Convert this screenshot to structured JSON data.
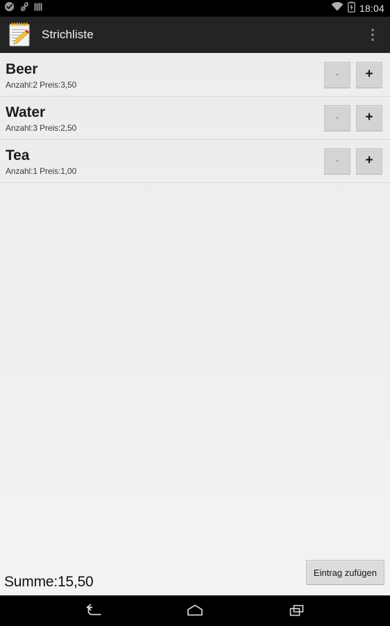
{
  "status_bar": {
    "left_icons": [
      {
        "name": "check-circle-icon"
      },
      {
        "name": "phone-link-icon"
      },
      {
        "name": "tally-bars-icon"
      }
    ],
    "right_icons": [
      {
        "name": "wifi-icon"
      },
      {
        "name": "battery-charging-icon"
      }
    ],
    "clock": "18:04"
  },
  "action_bar": {
    "app_icon": "notepad-pencil-icon",
    "title": "Strichliste",
    "overflow": "overflow-menu-icon"
  },
  "list": {
    "rows": [
      {
        "title": "Beer",
        "subtitle": "Anzahl:2 Preis:3,50",
        "count": 2,
        "price": "3,50",
        "minus_label": "-",
        "plus_label": "+"
      },
      {
        "title": "Water",
        "subtitle": "Anzahl:3 Preis:2,50",
        "count": 3,
        "price": "2,50",
        "minus_label": "-",
        "plus_label": "+"
      },
      {
        "title": "Tea",
        "subtitle": "Anzahl:1 Preis:1,00",
        "count": 1,
        "price": "1,00",
        "minus_label": "-",
        "plus_label": "+"
      }
    ]
  },
  "footer": {
    "sum_label": "Summe:15,50",
    "add_button_label": "Eintrag zufügen"
  },
  "nav_bar": {
    "back": "back-icon",
    "home": "home-icon",
    "recents": "recent-apps-icon"
  },
  "colors": {
    "status_bar_bg": "#000000",
    "action_bar_bg": "#242424",
    "content_bg": "#eceded",
    "row_divider": "#d8d8d8",
    "button_bg": "#d4d4d4",
    "title_text": "#1d1d1d",
    "nav_bar_bg": "#000000"
  }
}
